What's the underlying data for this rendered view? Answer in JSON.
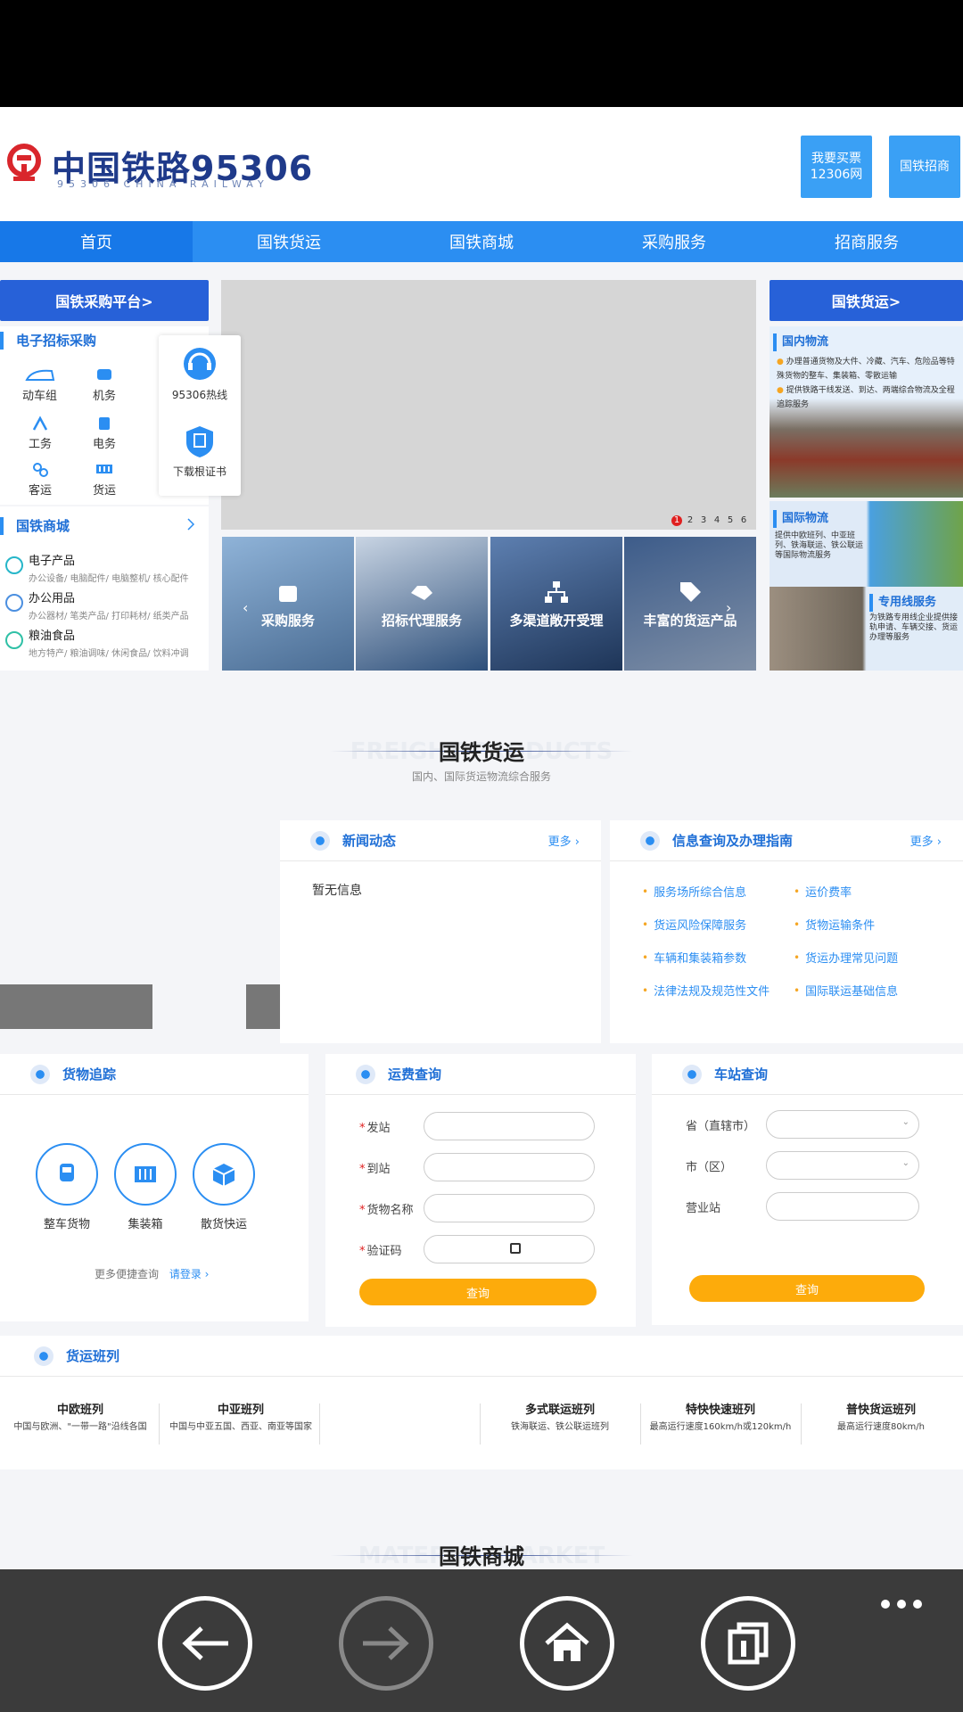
{
  "header": {
    "logo_title": "中国铁路95306",
    "logo_sub": "95306 CHINA RAILWAY",
    "btn_buy_line1": "我要买票",
    "btn_buy_line2": "12306网",
    "btn_invest": "国铁招商"
  },
  "nav": [
    "首页",
    "国铁货运",
    "国铁商城",
    "采购服务",
    "招商服务"
  ],
  "left": {
    "platform_btn": "国铁采购平台>",
    "bidding_title": "电子招标采购",
    "categories": [
      "动车组",
      "机务",
      "工务",
      "电务",
      "客运",
      "货运"
    ],
    "mall_title": "国铁商城",
    "mall_items": [
      {
        "name": "电子产品",
        "sub": "办公设备/ 电脑配件/ 电脑整机/ 核心配件"
      },
      {
        "name": "办公用品",
        "sub": "办公器材/ 笔类产品/ 打印耗材/ 纸类产品"
      },
      {
        "name": "粮油食品",
        "sub": "地方特产/ 粮油调味/ 休闲食品/ 饮料冲调"
      }
    ]
  },
  "float": {
    "hotline": "95306热线",
    "download": "下载根证书"
  },
  "carousel": {
    "dots": [
      "1",
      "2",
      "3",
      "4",
      "5",
      "6"
    ]
  },
  "tiles": [
    "采购服务",
    "招标代理服务",
    "多渠道敞开受理",
    "丰富的货运产品"
  ],
  "right": {
    "freight_btn": "国铁货运>",
    "domestic_title": "国内物流",
    "domestic_b1": "办理普通货物及大件、冷藏、汽车、危险品等特殊货物的整车、集装箱、零散运输",
    "domestic_b2": "提供铁路干线发送、到达、两端综合物流及全程追踪服务",
    "intl_title": "国际物流",
    "intl_text": "提供中欧班列、中亚班列、铁海联运、铁公联运等国际物流服务",
    "line_title": "专用线服务",
    "line_text": "为铁路专用线企业提供接轨申请、车辆交接、货运办理等服务"
  },
  "section1": {
    "title": "国铁货运",
    "bg": "FREIGHT PRODUCTS",
    "sub": "国内、国际货运物流综合服务"
  },
  "news": {
    "title": "新闻动态",
    "more": "更多",
    "empty": "暂无信息"
  },
  "guide": {
    "title": "信息查询及办理指南",
    "more": "更多",
    "links": [
      "服务场所综合信息",
      "运价费率",
      "货运风险保障服务",
      "货物运输条件",
      "车辆和集装箱参数",
      "货运办理常见问题",
      "法律法规及规范性文件",
      "国际联运基础信息"
    ]
  },
  "tracking": {
    "title": "货物追踪",
    "items": [
      "整车货物",
      "集装箱",
      "散货快运"
    ],
    "more_text": "更多便捷查询",
    "login": "请登录"
  },
  "fare": {
    "title": "运费查询",
    "fields": [
      "发站",
      "到站",
      "货物名称",
      "验证码"
    ],
    "btn": "查询"
  },
  "station": {
    "title": "车站查询",
    "fields": [
      "省（直辖市）",
      "市（区）",
      "营业站"
    ],
    "btn": "查询"
  },
  "trains": {
    "title": "货运班列",
    "items": [
      {
        "name": "中欧班列",
        "desc": "中国与欧洲、\"一带一路\"沿线各国"
      },
      {
        "name": "中亚班列",
        "desc": "中国与中亚五国、西亚、南亚等国家"
      },
      {
        "name": "多式联运班列",
        "desc": "铁海联运、铁公联运班列"
      },
      {
        "name": "特快快速班列",
        "desc": "最高运行速度160km/h或120km/h"
      },
      {
        "name": "普快货运班列",
        "desc": "最高运行速度80km/h"
      }
    ]
  },
  "section2": {
    "title": "国铁商城",
    "bg": "MATERIAL MARKET"
  }
}
